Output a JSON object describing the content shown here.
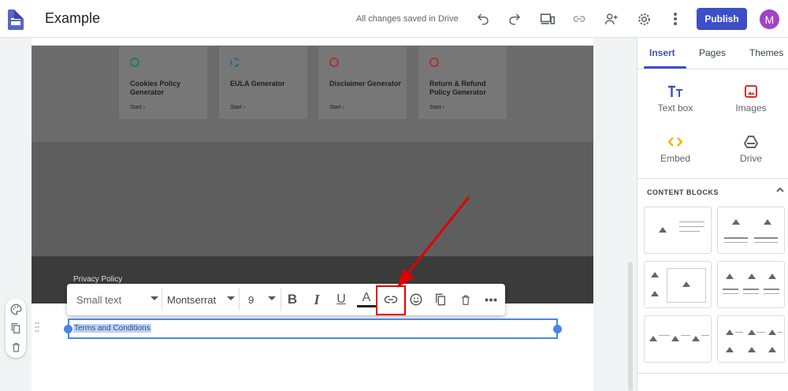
{
  "header": {
    "app_icon": "google-sites-logo",
    "title": "Example",
    "save_status": "All changes saved in Drive",
    "publish_label": "Publish",
    "avatar_initial": "M",
    "icons": [
      "undo-icon",
      "redo-icon",
      "preview-icon",
      "link-icon",
      "share-icon",
      "settings-icon",
      "more-vert-icon"
    ]
  },
  "page": {
    "cards": [
      {
        "title": "Cookies Policy Generator",
        "start": "Start ›",
        "icon_color": "#2a7a5a"
      },
      {
        "title": "EULA Generator",
        "start": "Start ›",
        "icon_color": "#2a6a8a"
      },
      {
        "title": "Disclaimer Generator",
        "start": "Start ›",
        "icon_color": "#b03030"
      },
      {
        "title": "Return & Refund Policy Generator",
        "start": "Start ›",
        "icon_color": "#b03030"
      }
    ],
    "footer_link": "Privacy Policy",
    "selected_text": "Terms and Conditions"
  },
  "format_toolbar": {
    "style_value": "Small text",
    "font_value": "Montserrat",
    "size_value": "9",
    "bold": "B",
    "italic": "I",
    "underline": "U",
    "text_color": "A",
    "buttons": [
      "bold-icon",
      "italic-icon",
      "underline-icon",
      "text-color-icon",
      "insert-link-icon",
      "emoji-icon",
      "copy-icon",
      "delete-icon",
      "more-horiz-icon"
    ]
  },
  "side_tools": [
    "palette-icon",
    "duplicate-icon",
    "delete-icon"
  ],
  "panel": {
    "tabs": [
      {
        "label": "Insert",
        "active": true
      },
      {
        "label": "Pages",
        "active": false
      },
      {
        "label": "Themes",
        "active": false
      }
    ],
    "insert_items": [
      {
        "label": "Text box",
        "icon": "text-box-icon",
        "color": "#3d4fc7"
      },
      {
        "label": "Images",
        "icon": "image-icon",
        "color": "#d93025"
      },
      {
        "label": "Embed",
        "icon": "embed-icon",
        "color": "#f4b400"
      },
      {
        "label": "Drive",
        "icon": "drive-icon",
        "color": "#5f6368"
      }
    ],
    "content_blocks_label": "CONTENT BLOCKS"
  },
  "colors": {
    "accent": "#3d4fc7",
    "annotation": "#e00000",
    "selection": "#4a86e8"
  }
}
